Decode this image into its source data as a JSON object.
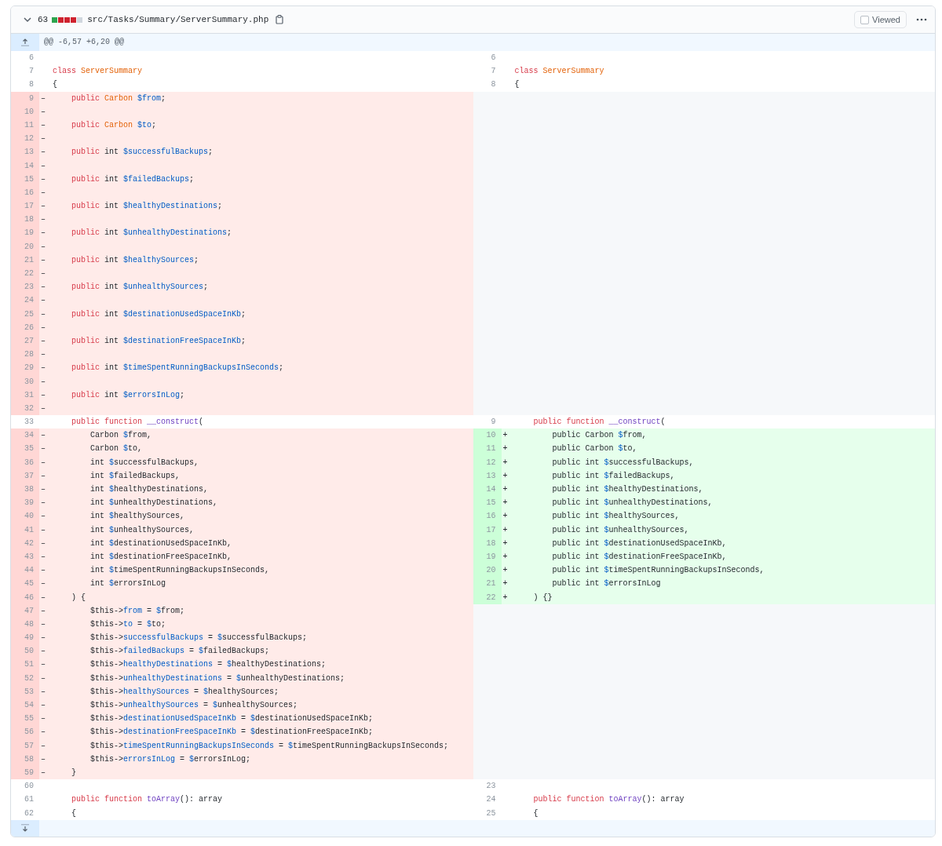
{
  "header": {
    "changes": "63",
    "diffstat": [
      {
        "color": "#2da44e"
      },
      {
        "color": "#cf222e"
      },
      {
        "color": "#cf222e"
      },
      {
        "color": "#cf222e"
      },
      {
        "color": "#d0d7de"
      }
    ],
    "filename": "src/Tasks/Summary/ServerSummary.php",
    "viewed": {
      "label": "Viewed",
      "checked": false
    }
  },
  "hunk": "@@ -6,57 +6,20 @@",
  "rows": [
    {
      "left": {
        "num": "6",
        "kind": "context"
      },
      "right": {
        "num": "6",
        "kind": "context"
      }
    },
    {
      "left": {
        "num": "7",
        "kind": "context",
        "code": [
          {
            "kind": "keyword",
            "text": "class "
          },
          {
            "kind": "type",
            "text": "ServerSummary"
          }
        ]
      },
      "right": {
        "num": "7",
        "kind": "context",
        "code": [
          {
            "kind": "keyword",
            "text": "class "
          },
          {
            "kind": "type",
            "text": "ServerSummary"
          }
        ]
      }
    },
    {
      "left": {
        "num": "8",
        "kind": "context",
        "code": [
          {
            "kind": "plain",
            "text": "{"
          }
        ]
      },
      "right": {
        "num": "8",
        "kind": "context",
        "code": [
          {
            "kind": "plain",
            "text": "{"
          }
        ]
      }
    },
    {
      "left": {
        "num": "9",
        "kind": "deletion",
        "marker": "–",
        "code": [
          {
            "kind": "keyword",
            "text": "    public "
          },
          {
            "kind": "type",
            "text": "Carbon "
          },
          {
            "kind": "variable",
            "text": "$from"
          },
          {
            "kind": "plain",
            "text": ";"
          }
        ]
      },
      "right": {
        "kind": "empty"
      }
    },
    {
      "left": {
        "num": "10",
        "kind": "deletion",
        "marker": "–"
      },
      "right": {
        "kind": "empty"
      }
    },
    {
      "left": {
        "num": "11",
        "kind": "deletion",
        "marker": "–",
        "code": [
          {
            "kind": "keyword",
            "text": "    public "
          },
          {
            "kind": "type",
            "text": "Carbon "
          },
          {
            "kind": "variable",
            "text": "$to"
          },
          {
            "kind": "plain",
            "text": ";"
          }
        ]
      },
      "right": {
        "kind": "empty"
      }
    },
    {
      "left": {
        "num": "12",
        "kind": "deletion",
        "marker": "–"
      },
      "right": {
        "kind": "empty"
      }
    },
    {
      "left": {
        "num": "13",
        "kind": "deletion",
        "marker": "–",
        "code": [
          {
            "kind": "keyword",
            "text": "    public"
          },
          {
            "kind": "plain",
            "text": " int "
          },
          {
            "kind": "variable",
            "text": "$successfulBackups"
          },
          {
            "kind": "plain",
            "text": ";"
          }
        ]
      },
      "right": {
        "kind": "empty"
      }
    },
    {
      "left": {
        "num": "14",
        "kind": "deletion",
        "marker": "–"
      },
      "right": {
        "kind": "empty"
      }
    },
    {
      "left": {
        "num": "15",
        "kind": "deletion",
        "marker": "–",
        "code": [
          {
            "kind": "keyword",
            "text": "    public"
          },
          {
            "kind": "plain",
            "text": " int "
          },
          {
            "kind": "variable",
            "text": "$failedBackups"
          },
          {
            "kind": "plain",
            "text": ";"
          }
        ]
      },
      "right": {
        "kind": "empty"
      }
    },
    {
      "left": {
        "num": "16",
        "kind": "deletion",
        "marker": "–"
      },
      "right": {
        "kind": "empty"
      }
    },
    {
      "left": {
        "num": "17",
        "kind": "deletion",
        "marker": "–",
        "code": [
          {
            "kind": "keyword",
            "text": "    public"
          },
          {
            "kind": "plain",
            "text": " int "
          },
          {
            "kind": "variable",
            "text": "$healthyDestinations"
          },
          {
            "kind": "plain",
            "text": ";"
          }
        ]
      },
      "right": {
        "kind": "empty"
      }
    },
    {
      "left": {
        "num": "18",
        "kind": "deletion",
        "marker": "–"
      },
      "right": {
        "kind": "empty"
      }
    },
    {
      "left": {
        "num": "19",
        "kind": "deletion",
        "marker": "–",
        "code": [
          {
            "kind": "keyword",
            "text": "    public"
          },
          {
            "kind": "plain",
            "text": " int "
          },
          {
            "kind": "variable",
            "text": "$unhealthyDestinations"
          },
          {
            "kind": "plain",
            "text": ";"
          }
        ]
      },
      "right": {
        "kind": "empty"
      }
    },
    {
      "left": {
        "num": "20",
        "kind": "deletion",
        "marker": "–"
      },
      "right": {
        "kind": "empty"
      }
    },
    {
      "left": {
        "num": "21",
        "kind": "deletion",
        "marker": "–",
        "code": [
          {
            "kind": "keyword",
            "text": "    public"
          },
          {
            "kind": "plain",
            "text": " int "
          },
          {
            "kind": "variable",
            "text": "$healthySources"
          },
          {
            "kind": "plain",
            "text": ";"
          }
        ]
      },
      "right": {
        "kind": "empty"
      }
    },
    {
      "left": {
        "num": "22",
        "kind": "deletion",
        "marker": "–"
      },
      "right": {
        "kind": "empty"
      }
    },
    {
      "left": {
        "num": "23",
        "kind": "deletion",
        "marker": "–",
        "code": [
          {
            "kind": "keyword",
            "text": "    public"
          },
          {
            "kind": "plain",
            "text": " int "
          },
          {
            "kind": "variable",
            "text": "$unhealthySources"
          },
          {
            "kind": "plain",
            "text": ";"
          }
        ]
      },
      "right": {
        "kind": "empty"
      }
    },
    {
      "left": {
        "num": "24",
        "kind": "deletion",
        "marker": "–"
      },
      "right": {
        "kind": "empty"
      }
    },
    {
      "left": {
        "num": "25",
        "kind": "deletion",
        "marker": "–",
        "code": [
          {
            "kind": "keyword",
            "text": "    public"
          },
          {
            "kind": "plain",
            "text": " int "
          },
          {
            "kind": "variable",
            "text": "$destinationUsedSpaceInKb"
          },
          {
            "kind": "plain",
            "text": ";"
          }
        ]
      },
      "right": {
        "kind": "empty"
      }
    },
    {
      "left": {
        "num": "26",
        "kind": "deletion",
        "marker": "–"
      },
      "right": {
        "kind": "empty"
      }
    },
    {
      "left": {
        "num": "27",
        "kind": "deletion",
        "marker": "–",
        "code": [
          {
            "kind": "keyword",
            "text": "    public"
          },
          {
            "kind": "plain",
            "text": " int "
          },
          {
            "kind": "variable",
            "text": "$destinationFreeSpaceInKb"
          },
          {
            "kind": "plain",
            "text": ";"
          }
        ]
      },
      "right": {
        "kind": "empty"
      }
    },
    {
      "left": {
        "num": "28",
        "kind": "deletion",
        "marker": "–"
      },
      "right": {
        "kind": "empty"
      }
    },
    {
      "left": {
        "num": "29",
        "kind": "deletion",
        "marker": "–",
        "code": [
          {
            "kind": "keyword",
            "text": "    public"
          },
          {
            "kind": "plain",
            "text": " int "
          },
          {
            "kind": "variable",
            "text": "$timeSpentRunningBackupsInSeconds"
          },
          {
            "kind": "plain",
            "text": ";"
          }
        ]
      },
      "right": {
        "kind": "empty"
      }
    },
    {
      "left": {
        "num": "30",
        "kind": "deletion",
        "marker": "–"
      },
      "right": {
        "kind": "empty"
      }
    },
    {
      "left": {
        "num": "31",
        "kind": "deletion",
        "marker": "–",
        "code": [
          {
            "kind": "keyword",
            "text": "    public"
          },
          {
            "kind": "plain",
            "text": " int "
          },
          {
            "kind": "variable",
            "text": "$errorsInLog"
          },
          {
            "kind": "plain",
            "text": ";"
          }
        ]
      },
      "right": {
        "kind": "empty"
      }
    },
    {
      "left": {
        "num": "32",
        "kind": "deletion",
        "marker": "–"
      },
      "right": {
        "kind": "empty"
      }
    },
    {
      "left": {
        "num": "33",
        "kind": "context",
        "code": [
          {
            "kind": "keyword",
            "text": "    public function "
          },
          {
            "kind": "function",
            "text": "__construct"
          },
          {
            "kind": "plain",
            "text": "("
          }
        ]
      },
      "right": {
        "num": "9",
        "kind": "context",
        "code": [
          {
            "kind": "keyword",
            "text": "    public function "
          },
          {
            "kind": "function",
            "text": "__construct"
          },
          {
            "kind": "plain",
            "text": "("
          }
        ]
      }
    },
    {
      "left": {
        "num": "34",
        "kind": "deletion",
        "marker": "–",
        "code": [
          {
            "kind": "plain",
            "text": "        Carbon "
          },
          {
            "kind": "variable",
            "text": "$"
          },
          {
            "kind": "plain",
            "text": "from,"
          }
        ]
      },
      "right": {
        "num": "10",
        "kind": "addition",
        "marker": "+",
        "code": [
          {
            "kind": "plain",
            "text": "        public Carbon "
          },
          {
            "kind": "variable",
            "text": "$"
          },
          {
            "kind": "plain",
            "text": "from,"
          }
        ]
      }
    },
    {
      "left": {
        "num": "35",
        "kind": "deletion",
        "marker": "–",
        "code": [
          {
            "kind": "plain",
            "text": "        Carbon "
          },
          {
            "kind": "variable",
            "text": "$"
          },
          {
            "kind": "plain",
            "text": "to,"
          }
        ]
      },
      "right": {
        "num": "11",
        "kind": "addition",
        "marker": "+",
        "code": [
          {
            "kind": "plain",
            "text": "        public Carbon "
          },
          {
            "kind": "variable",
            "text": "$"
          },
          {
            "kind": "plain",
            "text": "to,"
          }
        ]
      }
    },
    {
      "left": {
        "num": "36",
        "kind": "deletion",
        "marker": "–",
        "code": [
          {
            "kind": "plain",
            "text": "        int "
          },
          {
            "kind": "variable",
            "text": "$"
          },
          {
            "kind": "plain",
            "text": "successfulBackups,"
          }
        ]
      },
      "right": {
        "num": "12",
        "kind": "addition",
        "marker": "+",
        "code": [
          {
            "kind": "plain",
            "text": "        public int "
          },
          {
            "kind": "variable",
            "text": "$"
          },
          {
            "kind": "plain",
            "text": "successfulBackups,"
          }
        ]
      }
    },
    {
      "left": {
        "num": "37",
        "kind": "deletion",
        "marker": "–",
        "code": [
          {
            "kind": "plain",
            "text": "        int "
          },
          {
            "kind": "variable",
            "text": "$"
          },
          {
            "kind": "plain",
            "text": "failedBackups,"
          }
        ]
      },
      "right": {
        "num": "13",
        "kind": "addition",
        "marker": "+",
        "code": [
          {
            "kind": "plain",
            "text": "        public int "
          },
          {
            "kind": "variable",
            "text": "$"
          },
          {
            "kind": "plain",
            "text": "failedBackups,"
          }
        ]
      }
    },
    {
      "left": {
        "num": "38",
        "kind": "deletion",
        "marker": "–",
        "code": [
          {
            "kind": "plain",
            "text": "        int "
          },
          {
            "kind": "variable",
            "text": "$"
          },
          {
            "kind": "plain",
            "text": "healthyDestinations,"
          }
        ]
      },
      "right": {
        "num": "14",
        "kind": "addition",
        "marker": "+",
        "code": [
          {
            "kind": "plain",
            "text": "        public int "
          },
          {
            "kind": "variable",
            "text": "$"
          },
          {
            "kind": "plain",
            "text": "healthyDestinations,"
          }
        ]
      }
    },
    {
      "left": {
        "num": "39",
        "kind": "deletion",
        "marker": "–",
        "code": [
          {
            "kind": "plain",
            "text": "        int "
          },
          {
            "kind": "variable",
            "text": "$"
          },
          {
            "kind": "plain",
            "text": "unhealthyDestinations,"
          }
        ]
      },
      "right": {
        "num": "15",
        "kind": "addition",
        "marker": "+",
        "code": [
          {
            "kind": "plain",
            "text": "        public int "
          },
          {
            "kind": "variable",
            "text": "$"
          },
          {
            "kind": "plain",
            "text": "unhealthyDestinations,"
          }
        ]
      }
    },
    {
      "left": {
        "num": "40",
        "kind": "deletion",
        "marker": "–",
        "code": [
          {
            "kind": "plain",
            "text": "        int "
          },
          {
            "kind": "variable",
            "text": "$"
          },
          {
            "kind": "plain",
            "text": "healthySources,"
          }
        ]
      },
      "right": {
        "num": "16",
        "kind": "addition",
        "marker": "+",
        "code": [
          {
            "kind": "plain",
            "text": "        public int "
          },
          {
            "kind": "variable",
            "text": "$"
          },
          {
            "kind": "plain",
            "text": "healthySources,"
          }
        ]
      }
    },
    {
      "left": {
        "num": "41",
        "kind": "deletion",
        "marker": "–",
        "code": [
          {
            "kind": "plain",
            "text": "        int "
          },
          {
            "kind": "variable",
            "text": "$"
          },
          {
            "kind": "plain",
            "text": "unhealthySources,"
          }
        ]
      },
      "right": {
        "num": "17",
        "kind": "addition",
        "marker": "+",
        "code": [
          {
            "kind": "plain",
            "text": "        public int "
          },
          {
            "kind": "variable",
            "text": "$"
          },
          {
            "kind": "plain",
            "text": "unhealthySources,"
          }
        ]
      }
    },
    {
      "left": {
        "num": "42",
        "kind": "deletion",
        "marker": "–",
        "code": [
          {
            "kind": "plain",
            "text": "        int "
          },
          {
            "kind": "variable",
            "text": "$"
          },
          {
            "kind": "plain",
            "text": "destinationUsedSpaceInKb,"
          }
        ]
      },
      "right": {
        "num": "18",
        "kind": "addition",
        "marker": "+",
        "code": [
          {
            "kind": "plain",
            "text": "        public int "
          },
          {
            "kind": "variable",
            "text": "$"
          },
          {
            "kind": "plain",
            "text": "destinationUsedSpaceInKb,"
          }
        ]
      }
    },
    {
      "left": {
        "num": "43",
        "kind": "deletion",
        "marker": "–",
        "code": [
          {
            "kind": "plain",
            "text": "        int "
          },
          {
            "kind": "variable",
            "text": "$"
          },
          {
            "kind": "plain",
            "text": "destinationFreeSpaceInKb,"
          }
        ]
      },
      "right": {
        "num": "19",
        "kind": "addition",
        "marker": "+",
        "code": [
          {
            "kind": "plain",
            "text": "        public int "
          },
          {
            "kind": "variable",
            "text": "$"
          },
          {
            "kind": "plain",
            "text": "destinationFreeSpaceInKb,"
          }
        ]
      }
    },
    {
      "left": {
        "num": "44",
        "kind": "deletion",
        "marker": "–",
        "code": [
          {
            "kind": "plain",
            "text": "        int "
          },
          {
            "kind": "variable",
            "text": "$"
          },
          {
            "kind": "plain",
            "text": "timeSpentRunningBackupsInSeconds,"
          }
        ]
      },
      "right": {
        "num": "20",
        "kind": "addition",
        "marker": "+",
        "code": [
          {
            "kind": "plain",
            "text": "        public int "
          },
          {
            "kind": "variable",
            "text": "$"
          },
          {
            "kind": "plain",
            "text": "timeSpentRunningBackupsInSeconds,"
          }
        ]
      }
    },
    {
      "left": {
        "num": "45",
        "kind": "deletion",
        "marker": "–",
        "code": [
          {
            "kind": "plain",
            "text": "        int "
          },
          {
            "kind": "variable",
            "text": "$"
          },
          {
            "kind": "plain",
            "text": "errorsInLog"
          }
        ]
      },
      "right": {
        "num": "21",
        "kind": "addition",
        "marker": "+",
        "code": [
          {
            "kind": "plain",
            "text": "        public int "
          },
          {
            "kind": "variable",
            "text": "$"
          },
          {
            "kind": "plain",
            "text": "errorsInLog"
          }
        ]
      }
    },
    {
      "left": {
        "num": "46",
        "kind": "deletion",
        "marker": "–",
        "code": [
          {
            "kind": "plain",
            "text": "    ) {"
          }
        ]
      },
      "right": {
        "num": "22",
        "kind": "addition",
        "marker": "+",
        "code": [
          {
            "kind": "plain",
            "text": "    ) {}"
          }
        ]
      }
    },
    {
      "left": {
        "num": "47",
        "kind": "deletion",
        "marker": "–",
        "code": [
          {
            "kind": "plain",
            "text": "        $this->"
          },
          {
            "kind": "variable",
            "text": "from"
          },
          {
            "kind": "plain",
            "text": " = "
          },
          {
            "kind": "variable",
            "text": "$"
          },
          {
            "kind": "plain",
            "text": "from;"
          }
        ]
      },
      "right": {
        "kind": "empty"
      }
    },
    {
      "left": {
        "num": "48",
        "kind": "deletion",
        "marker": "–",
        "code": [
          {
            "kind": "plain",
            "text": "        $this->"
          },
          {
            "kind": "variable",
            "text": "to"
          },
          {
            "kind": "plain",
            "text": " = "
          },
          {
            "kind": "variable",
            "text": "$"
          },
          {
            "kind": "plain",
            "text": "to;"
          }
        ]
      },
      "right": {
        "kind": "empty"
      }
    },
    {
      "left": {
        "num": "49",
        "kind": "deletion",
        "marker": "–",
        "code": [
          {
            "kind": "plain",
            "text": "        $this->"
          },
          {
            "kind": "variable",
            "text": "successfulBackups"
          },
          {
            "kind": "plain",
            "text": " = "
          },
          {
            "kind": "variable",
            "text": "$"
          },
          {
            "kind": "plain",
            "text": "successfulBackups;"
          }
        ]
      },
      "right": {
        "kind": "empty"
      }
    },
    {
      "left": {
        "num": "50",
        "kind": "deletion",
        "marker": "–",
        "code": [
          {
            "kind": "plain",
            "text": "        $this->"
          },
          {
            "kind": "variable",
            "text": "failedBackups"
          },
          {
            "kind": "plain",
            "text": " = "
          },
          {
            "kind": "variable",
            "text": "$"
          },
          {
            "kind": "plain",
            "text": "failedBackups;"
          }
        ]
      },
      "right": {
        "kind": "empty"
      }
    },
    {
      "left": {
        "num": "51",
        "kind": "deletion",
        "marker": "–",
        "code": [
          {
            "kind": "plain",
            "text": "        $this->"
          },
          {
            "kind": "variable",
            "text": "healthyDestinations"
          },
          {
            "kind": "plain",
            "text": " = "
          },
          {
            "kind": "variable",
            "text": "$"
          },
          {
            "kind": "plain",
            "text": "healthyDestinations;"
          }
        ]
      },
      "right": {
        "kind": "empty"
      }
    },
    {
      "left": {
        "num": "52",
        "kind": "deletion",
        "marker": "–",
        "code": [
          {
            "kind": "plain",
            "text": "        $this->"
          },
          {
            "kind": "variable",
            "text": "unhealthyDestinations"
          },
          {
            "kind": "plain",
            "text": " = "
          },
          {
            "kind": "variable",
            "text": "$"
          },
          {
            "kind": "plain",
            "text": "unhealthyDestinations;"
          }
        ]
      },
      "right": {
        "kind": "empty"
      }
    },
    {
      "left": {
        "num": "53",
        "kind": "deletion",
        "marker": "–",
        "code": [
          {
            "kind": "plain",
            "text": "        $this->"
          },
          {
            "kind": "variable",
            "text": "healthySources"
          },
          {
            "kind": "plain",
            "text": " = "
          },
          {
            "kind": "variable",
            "text": "$"
          },
          {
            "kind": "plain",
            "text": "healthySources;"
          }
        ]
      },
      "right": {
        "kind": "empty"
      }
    },
    {
      "left": {
        "num": "54",
        "kind": "deletion",
        "marker": "–",
        "code": [
          {
            "kind": "plain",
            "text": "        $this->"
          },
          {
            "kind": "variable",
            "text": "unhealthySources"
          },
          {
            "kind": "plain",
            "text": " = "
          },
          {
            "kind": "variable",
            "text": "$"
          },
          {
            "kind": "plain",
            "text": "unhealthySources;"
          }
        ]
      },
      "right": {
        "kind": "empty"
      }
    },
    {
      "left": {
        "num": "55",
        "kind": "deletion",
        "marker": "–",
        "code": [
          {
            "kind": "plain",
            "text": "        $this->"
          },
          {
            "kind": "variable",
            "text": "destinationUsedSpaceInKb"
          },
          {
            "kind": "plain",
            "text": " = "
          },
          {
            "kind": "variable",
            "text": "$"
          },
          {
            "kind": "plain",
            "text": "destinationUsedSpaceInKb;"
          }
        ]
      },
      "right": {
        "kind": "empty"
      }
    },
    {
      "left": {
        "num": "56",
        "kind": "deletion",
        "marker": "–",
        "code": [
          {
            "kind": "plain",
            "text": "        $this->"
          },
          {
            "kind": "variable",
            "text": "destinationFreeSpaceInKb"
          },
          {
            "kind": "plain",
            "text": " = "
          },
          {
            "kind": "variable",
            "text": "$"
          },
          {
            "kind": "plain",
            "text": "destinationFreeSpaceInKb;"
          }
        ]
      },
      "right": {
        "kind": "empty"
      }
    },
    {
      "left": {
        "num": "57",
        "kind": "deletion",
        "marker": "–",
        "code": [
          {
            "kind": "plain",
            "text": "        $this->"
          },
          {
            "kind": "variable",
            "text": "timeSpentRunningBackupsInSeconds"
          },
          {
            "kind": "plain",
            "text": " = "
          },
          {
            "kind": "variable",
            "text": "$"
          },
          {
            "kind": "plain",
            "text": "timeSpentRunningBackupsInSeconds;"
          }
        ]
      },
      "right": {
        "kind": "empty"
      }
    },
    {
      "left": {
        "num": "58",
        "kind": "deletion",
        "marker": "–",
        "code": [
          {
            "kind": "plain",
            "text": "        $this->"
          },
          {
            "kind": "variable",
            "text": "errorsInLog"
          },
          {
            "kind": "plain",
            "text": " = "
          },
          {
            "kind": "variable",
            "text": "$"
          },
          {
            "kind": "plain",
            "text": "errorsInLog;"
          }
        ]
      },
      "right": {
        "kind": "empty"
      }
    },
    {
      "left": {
        "num": "59",
        "kind": "deletion",
        "marker": "–",
        "code": [
          {
            "kind": "plain",
            "text": "    }"
          }
        ]
      },
      "right": {
        "kind": "empty"
      }
    },
    {
      "left": {
        "num": "60",
        "kind": "context"
      },
      "right": {
        "num": "23",
        "kind": "context"
      }
    },
    {
      "left": {
        "num": "61",
        "kind": "context",
        "code": [
          {
            "kind": "keyword",
            "text": "    public function "
          },
          {
            "kind": "function",
            "text": "toArray"
          },
          {
            "kind": "plain",
            "text": "(): array"
          }
        ]
      },
      "right": {
        "num": "24",
        "kind": "context",
        "code": [
          {
            "kind": "keyword",
            "text": "    public function "
          },
          {
            "kind": "function",
            "text": "toArray"
          },
          {
            "kind": "plain",
            "text": "(): array"
          }
        ]
      }
    },
    {
      "left": {
        "num": "62",
        "kind": "context",
        "code": [
          {
            "kind": "plain",
            "text": "    {"
          }
        ]
      },
      "right": {
        "num": "25",
        "kind": "context",
        "code": [
          {
            "kind": "plain",
            "text": "    {"
          }
        ]
      }
    }
  ]
}
